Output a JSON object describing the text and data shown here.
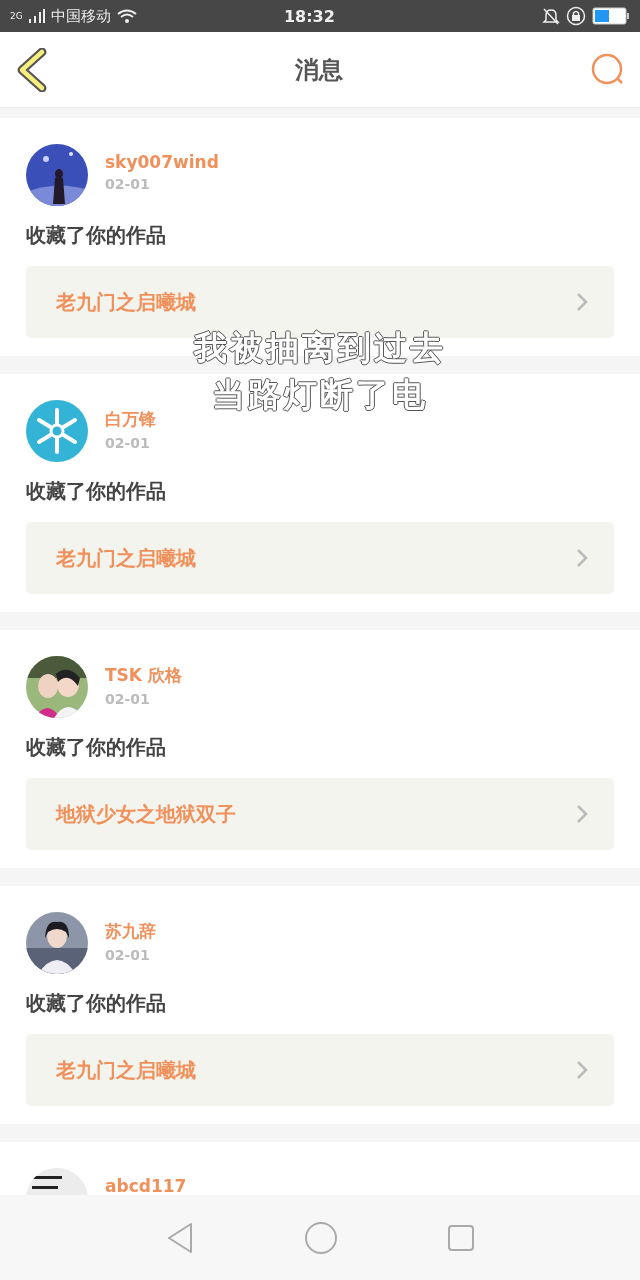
{
  "status_bar": {
    "network": "2G",
    "carrier": "中国移动",
    "time": "18:32"
  },
  "header": {
    "title": "消息"
  },
  "messages": [
    {
      "user": "sky007wind",
      "date": "02-01",
      "message": "收藏了你的作品",
      "work": "老九门之启曦城"
    },
    {
      "user": "白万锋",
      "date": "02-01",
      "message": "收藏了你的作品",
      "work": "老九门之启曦城"
    },
    {
      "user": "TSK 欣格",
      "date": "02-01",
      "message": "收藏了你的作品",
      "work": "地狱少女之地狱双子"
    },
    {
      "user": "苏九辞",
      "date": "02-01",
      "message": "收藏了你的作品",
      "work": "老九门之启曦城"
    },
    {
      "user": "abcd117"
    }
  ],
  "floating_lyrics": {
    "lines": [
      "我被抽离到过去",
      "当路灯断了电"
    ]
  }
}
